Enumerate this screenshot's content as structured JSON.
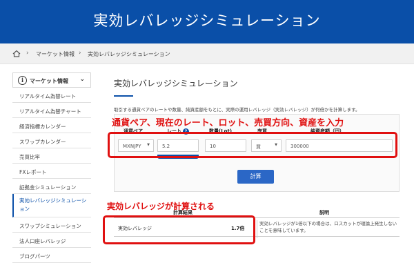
{
  "header": {
    "title": "実効レバレッジシミュレーション"
  },
  "breadcrumb": {
    "items": [
      "マーケット情報",
      "実効レバレッジシミュレーション"
    ]
  },
  "sidebar": {
    "heading": "マーケット情報",
    "info_symbol": "i",
    "items": [
      {
        "label": "リアルタイム為替レート"
      },
      {
        "label": "リアルタイム為替チャート"
      },
      {
        "label": "経済指標カレンダー"
      },
      {
        "label": "スワップカレンダー"
      },
      {
        "label": "売買比率"
      },
      {
        "label": "FXレポート"
      },
      {
        "label": "証拠金シミュレーション"
      },
      {
        "label": "実効レバレッジシミュレーション"
      },
      {
        "label": "スワップシミュレーション"
      },
      {
        "label": "法人口座レバレッジ"
      },
      {
        "label": "ブログパーツ"
      }
    ],
    "active_index": 7
  },
  "main": {
    "title": "実効レバレッジシミュレーション",
    "description": "取引する通貨ペアのレートや数量、純資産額をもとに、実際の運用レバレッジ（実効レバレッジ）が何倍かを計算します。",
    "form": {
      "labels": {
        "pair": "通貨ペア",
        "rate": "レート",
        "lots": "数量(Lot)",
        "side": "売買",
        "equity": "純資産額（円）"
      },
      "help_symbol": "?",
      "pair_value": "MXNJPY",
      "rate_value": "5.2",
      "lots_value": "10",
      "side_value": "買",
      "equity_value": "300000",
      "calc_label": "計算"
    },
    "result": {
      "col_result": "計算結果",
      "col_note": "説明",
      "row_label": "実効レバレッジ",
      "row_value": "1.7倍",
      "row_note": "実効レバレッジが1倍以下の場合は、ロスカットが理論上発生しないことを意味しています。"
    }
  },
  "annotations": {
    "input_callout": "通貨ペア、現在のレート、ロット、売買方向、資産を入力",
    "result_callout": "実効レバレッジが計算される",
    "color": "#e01010"
  },
  "colors": {
    "brand": "#0a4fa8",
    "button": "#2b67c6"
  }
}
